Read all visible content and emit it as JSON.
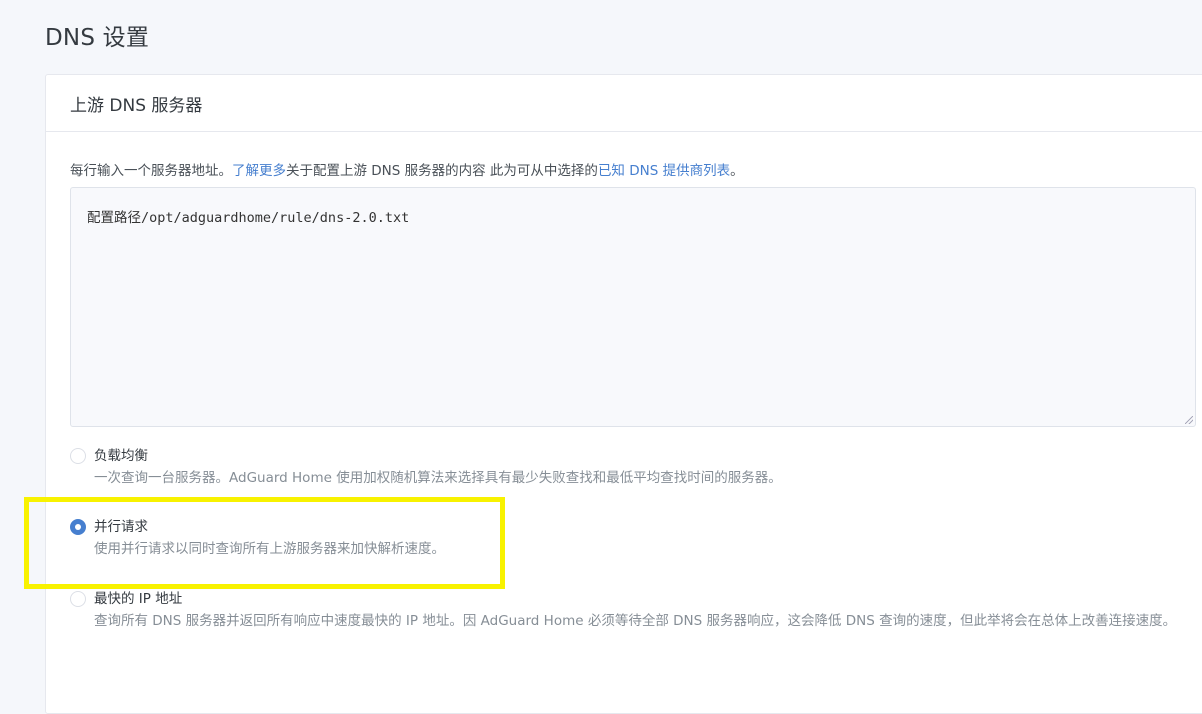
{
  "page": {
    "title": "DNS 设置"
  },
  "upstream": {
    "header": "上游 DNS 服务器",
    "hint_prefix": "每行输入一个服务器地址。",
    "learn_more_link": "了解更多",
    "hint_middle": "关于配置上游 DNS 服务器的内容 此为可从中选择的",
    "providers_link": "已知 DNS 提供商列表",
    "hint_suffix": "。",
    "textarea_value": "配置路径/opt/adguardhome/rule/dns-2.0.txt"
  },
  "options": [
    {
      "title": "负载均衡",
      "desc": "一次查询一台服务器。AdGuard Home 使用加权随机算法来选择具有最少失败查找和最低平均查找时间的服务器。",
      "checked": false
    },
    {
      "title": "并行请求",
      "desc": "使用并行请求以同时查询所有上游服务器来加快解析速度。",
      "checked": true
    },
    {
      "title": "最快的 IP 地址",
      "desc": "查询所有 DNS 服务器并返回所有响应中速度最快的 IP 地址。因 AdGuard Home 必须等待全部 DNS 服务器响应，这会降低 DNS 查询的速度，但此举将会在总体上改善连接速度。",
      "checked": false
    }
  ],
  "colors": {
    "accent": "#467fcf",
    "highlight": "#f8f200"
  }
}
